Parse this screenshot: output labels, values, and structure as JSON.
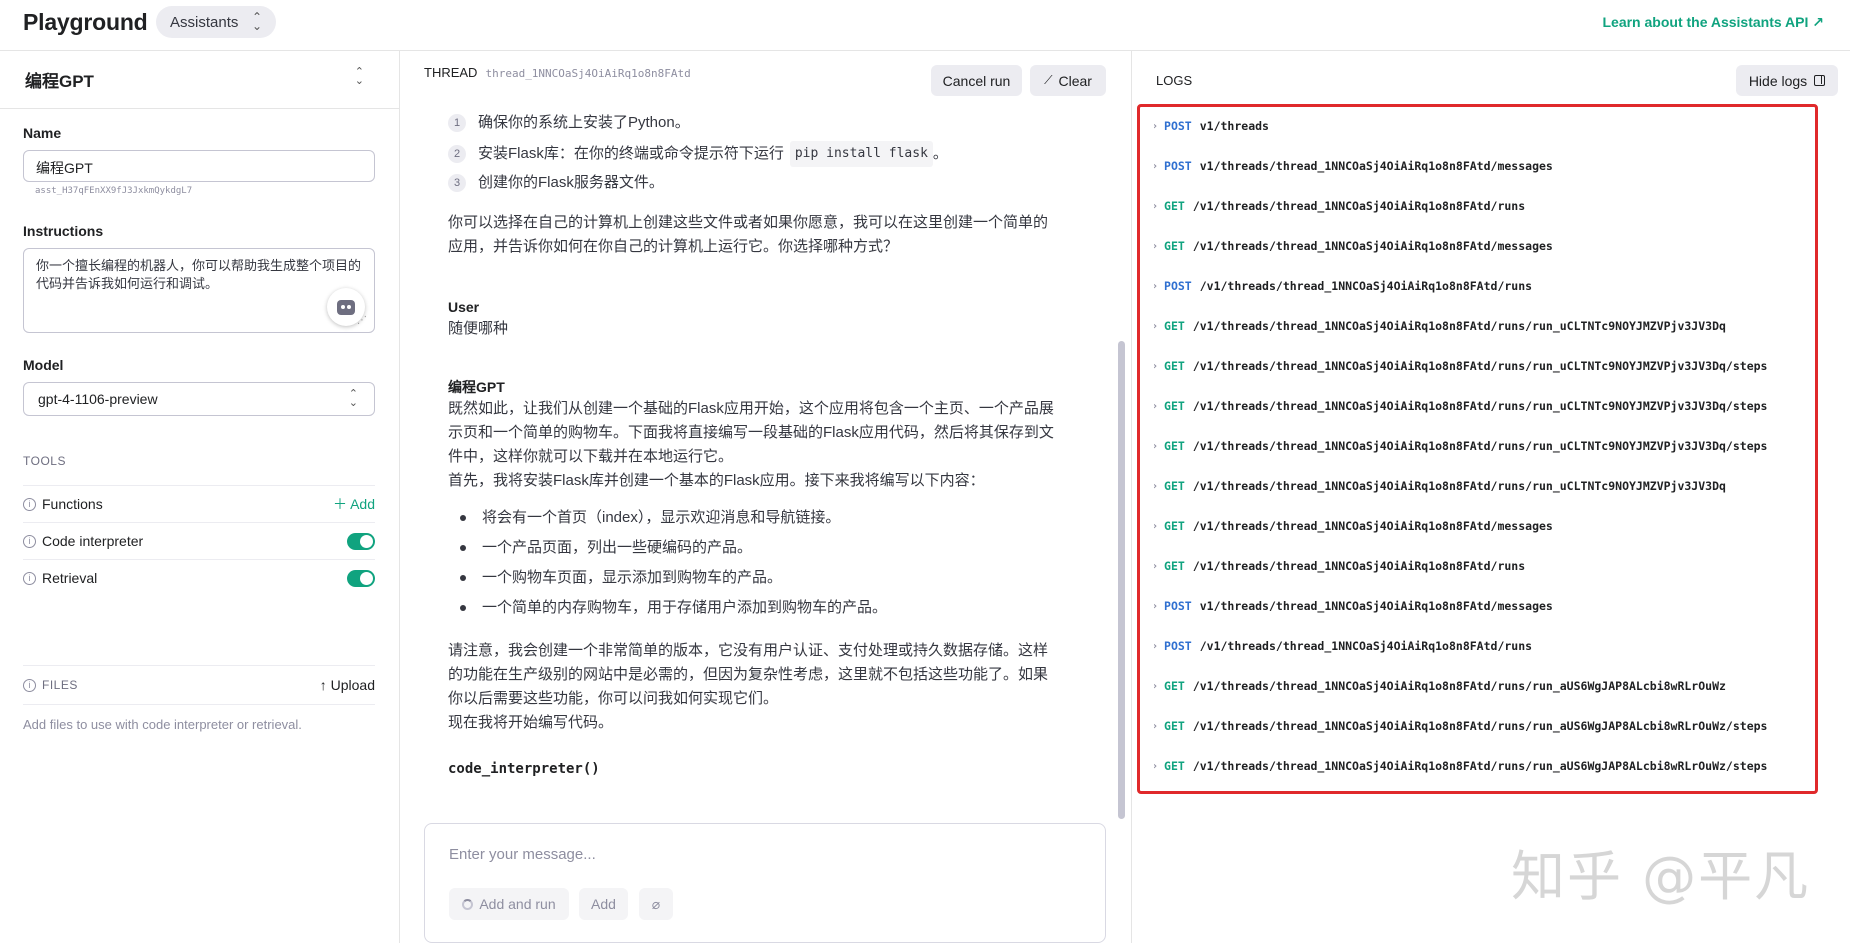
{
  "header": {
    "app_title": "Playground",
    "mode": "Assistants",
    "learn_link": "Learn about the Assistants API ↗"
  },
  "assistant": {
    "selected": "编程GPT",
    "name_label": "Name",
    "name_value": "编程GPT",
    "id": "asst_H37qFEnXX9fJ3JxkmQykdgL7",
    "instructions_label": "Instructions",
    "instructions_value": "你一个擅长编程的机器人，你可以帮助我生成整个项目的代码并告诉我如何运行和调试。",
    "model_label": "Model",
    "model_value": "gpt-4-1106-preview"
  },
  "tools": {
    "title": "TOOLS",
    "functions": "Functions",
    "add_label": "Add",
    "code_interpreter": "Code interpreter",
    "code_interpreter_enabled": true,
    "retrieval": "Retrieval",
    "retrieval_enabled": true
  },
  "files": {
    "title": "FILES",
    "upload_label": "Upload",
    "help": "Add files to use with code interpreter or retrieval."
  },
  "thread": {
    "label": "THREAD",
    "id": "thread_1NNCOaSj4OiAiRq1o8n8FAtd",
    "cancel_label": "Cancel run",
    "clear_label": "Clear",
    "steps": [
      {
        "num": "1",
        "text": "确保你的系统上安装了Python。"
      },
      {
        "num": "2",
        "text": "安装Flask库：在你的终端或命令提示符下运行",
        "code": "pip install flask",
        "tail": "。"
      },
      {
        "num": "3",
        "text": "创建你的Flask服务器文件。"
      }
    ],
    "para1": "你可以选择在自己的计算机上创建这些文件或者如果你愿意，我可以在这里创建一个简单的应用，并告诉你如何在你自己的计算机上运行它。你选择哪种方式？",
    "user_role": "User",
    "user_msg": "随便哪种",
    "asst_role": "编程GPT",
    "asst_para1": "既然如此，让我们从创建一个基础的Flask应用开始，这个应用将包含一个主页、一个产品展示页和一个简单的购物车。下面我将直接编写一段基础的Flask应用代码，然后将其保存到文件中，这样你就可以下载并在本地运行它。",
    "asst_para2": "首先，我将安装Flask库并创建一个基本的Flask应用。接下来我将编写以下内容：",
    "bullets": [
      "将会有一个首页（index），显示欢迎消息和导航链接。",
      "一个产品页面，列出一些硬编码的产品。",
      "一个购物车页面，显示添加到购物车的产品。",
      "一个简单的内存购物车，用于存储用户添加到购物车的产品。"
    ],
    "asst_para3": "请注意，我会创建一个非常简单的版本，它没有用户认证、支付处理或持久数据存储。这样的功能在生产级别的网站中是必需的，但因为复杂性考虑，这里就不包括这些功能了。如果你以后需要这些功能，你可以问我如何实现它们。",
    "asst_para4": "现在我将开始编写代码。",
    "code_call": "code_interpreter()",
    "composer_placeholder": "Enter your message...",
    "add_and_run": "Add and run",
    "add": "Add"
  },
  "logs": {
    "title": "LOGS",
    "hide_label": "Hide logs",
    "entries": [
      {
        "method": "POST",
        "path": "v1/threads"
      },
      {
        "method": "POST",
        "path": "v1/threads/thread_1NNCOaSj4OiAiRq1o8n8FAtd/messages"
      },
      {
        "method": "GET",
        "path": "/v1/threads/thread_1NNCOaSj4OiAiRq1o8n8FAtd/runs"
      },
      {
        "method": "GET",
        "path": "/v1/threads/thread_1NNCOaSj4OiAiRq1o8n8FAtd/messages"
      },
      {
        "method": "POST",
        "path": "/v1/threads/thread_1NNCOaSj4OiAiRq1o8n8FAtd/runs"
      },
      {
        "method": "GET",
        "path": "/v1/threads/thread_1NNCOaSj4OiAiRq1o8n8FAtd/runs/run_uCLTNTc9NOYJMZVPjv3JV3Dq"
      },
      {
        "method": "GET",
        "path": "/v1/threads/thread_1NNCOaSj4OiAiRq1o8n8FAtd/runs/run_uCLTNTc9NOYJMZVPjv3JV3Dq/steps"
      },
      {
        "method": "GET",
        "path": "/v1/threads/thread_1NNCOaSj4OiAiRq1o8n8FAtd/runs/run_uCLTNTc9NOYJMZVPjv3JV3Dq/steps"
      },
      {
        "method": "GET",
        "path": "/v1/threads/thread_1NNCOaSj4OiAiRq1o8n8FAtd/runs/run_uCLTNTc9NOYJMZVPjv3JV3Dq/steps"
      },
      {
        "method": "GET",
        "path": "/v1/threads/thread_1NNCOaSj4OiAiRq1o8n8FAtd/runs/run_uCLTNTc9NOYJMZVPjv3JV3Dq"
      },
      {
        "method": "GET",
        "path": "/v1/threads/thread_1NNCOaSj4OiAiRq1o8n8FAtd/messages"
      },
      {
        "method": "GET",
        "path": "/v1/threads/thread_1NNCOaSj4OiAiRq1o8n8FAtd/runs"
      },
      {
        "method": "POST",
        "path": "v1/threads/thread_1NNCOaSj4OiAiRq1o8n8FAtd/messages"
      },
      {
        "method": "POST",
        "path": "/v1/threads/thread_1NNCOaSj4OiAiRq1o8n8FAtd/runs"
      },
      {
        "method": "GET",
        "path": "/v1/threads/thread_1NNCOaSj4OiAiRq1o8n8FAtd/runs/run_aUS6WgJAP8ALcbi8wRLrOuWz"
      },
      {
        "method": "GET",
        "path": "/v1/threads/thread_1NNCOaSj4OiAiRq1o8n8FAtd/runs/run_aUS6WgJAP8ALcbi8wRLrOuWz/steps"
      },
      {
        "method": "GET",
        "path": "/v1/threads/thread_1NNCOaSj4OiAiRq1o8n8FAtd/runs/run_aUS6WgJAP8ALcbi8wRLrOuWz/steps"
      }
    ]
  },
  "watermark": "知乎 @平凡",
  "colors": {
    "accent": "#10a37f",
    "post": "#2f6fd0",
    "highlight": "#e0292b"
  }
}
